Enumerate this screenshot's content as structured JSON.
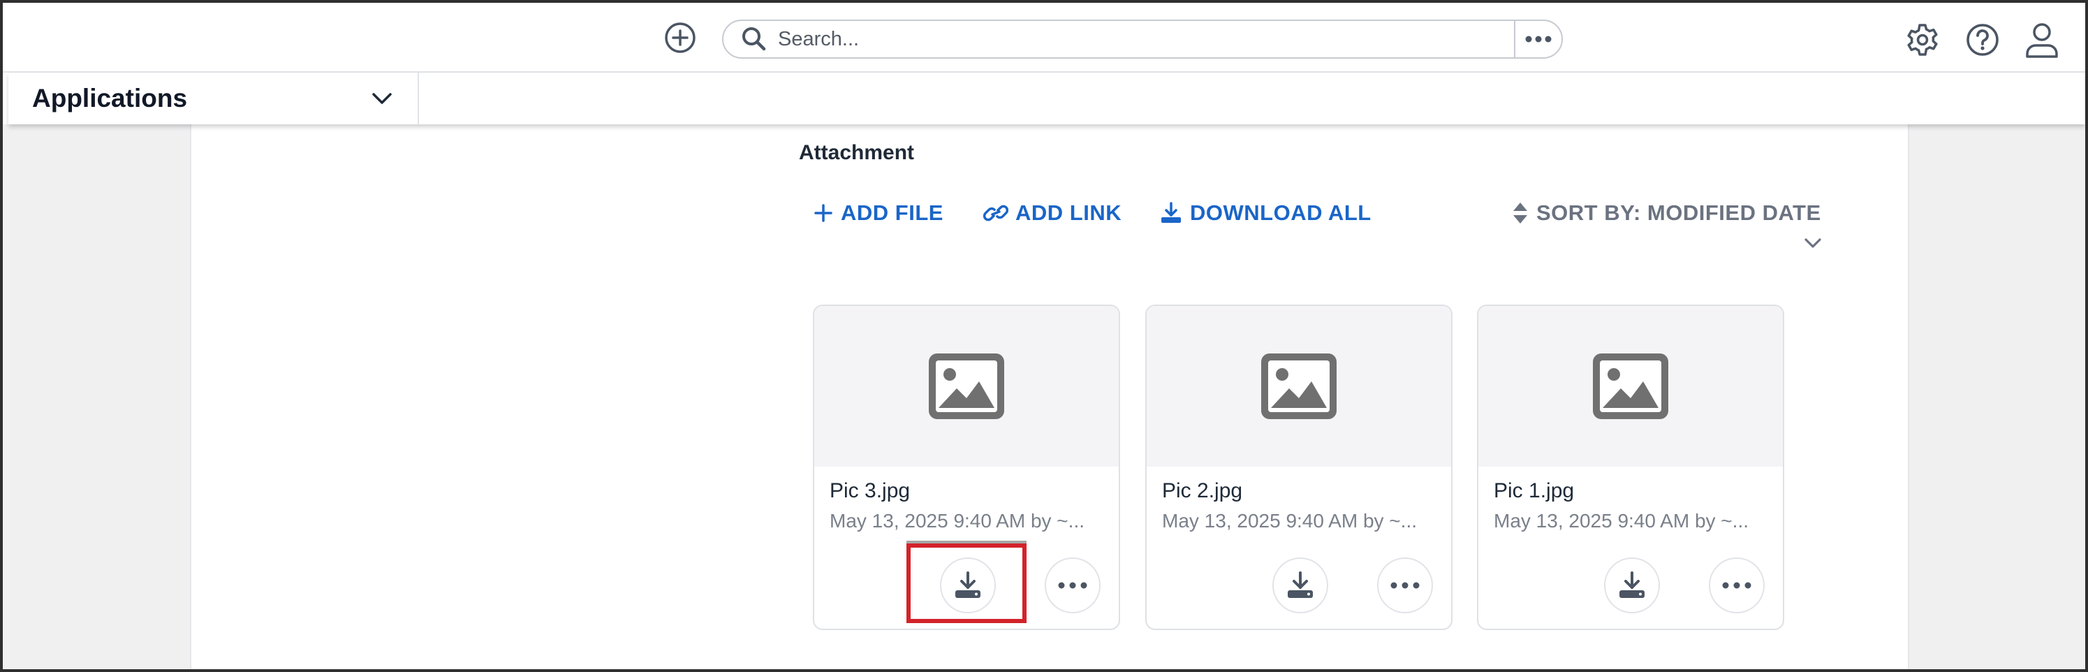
{
  "header": {
    "search_placeholder": "Search...",
    "icons": [
      "add-circle-icon",
      "search-icon",
      "more-horizontal-icon",
      "gear-icon",
      "help-icon",
      "user-icon"
    ]
  },
  "apps": {
    "label": "Applications"
  },
  "attachments": {
    "title": "Attachment",
    "actions": {
      "add_file": "ADD FILE",
      "add_link": "ADD LINK",
      "download_all": "DOWNLOAD ALL",
      "sort": "SORT BY: MODIFIED DATE"
    },
    "files": [
      {
        "name": "Pic 3.jpg",
        "meta": "May 13, 2025 9:40 AM by ~..."
      },
      {
        "name": "Pic 2.jpg",
        "meta": "May 13, 2025 9:40 AM by ~..."
      },
      {
        "name": "Pic 1.jpg",
        "meta": "May 13, 2025 9:40 AM by ~..."
      }
    ]
  },
  "colors": {
    "accent": "#1a65c8",
    "muted": "#6b7280",
    "highlight": "#d3232a",
    "thumb_icon": "#707070"
  }
}
